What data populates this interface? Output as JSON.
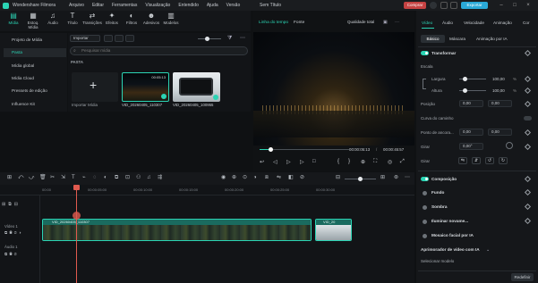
{
  "app": {
    "name": "Wondershare Filmora",
    "file_title": "Sem Título",
    "buy_label": "Comprar",
    "export_label": "Exportar"
  },
  "menu": [
    "Arquivo",
    "Editar",
    "Ferramentas",
    "Visualização",
    "Entendido",
    "Ajuda",
    "Versão"
  ],
  "toolbar": [
    {
      "label": "Mídia",
      "icon": "media-icon"
    },
    {
      "label": "Estoq. Mídia",
      "icon": "stock-media-icon"
    },
    {
      "label": "Áudio",
      "icon": "audio-icon"
    },
    {
      "label": "Título",
      "icon": "title-icon"
    },
    {
      "label": "Transições",
      "icon": "transitions-icon"
    },
    {
      "label": "Efeitos",
      "icon": "effects-icon"
    },
    {
      "label": "Filtros",
      "icon": "filters-icon"
    },
    {
      "label": "Adesivos",
      "icon": "stickers-icon"
    },
    {
      "label": "Modelos",
      "icon": "templates-icon"
    }
  ],
  "sidebar": {
    "items": [
      {
        "label": "Projeto de Mídia"
      },
      {
        "label": "Pasta"
      },
      {
        "label": "Mídia global"
      },
      {
        "label": "Mídia Cloud"
      },
      {
        "label": "Pressets de edição"
      },
      {
        "label": "Influence Kit"
      }
    ]
  },
  "media": {
    "import_label": "Importar",
    "search_placeholder": "Pesquisar mídia",
    "folder_label": "PASTA",
    "import_tile_label": "Importar Mídia",
    "items": [
      {
        "name": "VID_20260405_110307",
        "duration": "00:05:13"
      },
      {
        "name": "VID_20260405_100955",
        "duration": ""
      }
    ]
  },
  "preview": {
    "tab_timeline": "Linha do tempo",
    "tab_source": "Fonte",
    "quality": "Qualidade total",
    "current_time": "00:00:05:13",
    "total_time": "00:00:45:57"
  },
  "right": {
    "tabs": [
      "Vídeo",
      "Áudio",
      "Velocidade",
      "Animação",
      "Cor"
    ],
    "subtabs": [
      "Básico",
      "Máscara",
      "Animação por IA"
    ],
    "transform": "Transformar",
    "scale": "Escala",
    "width": "Largura",
    "width_value": "100,00",
    "height": "Altura",
    "height_value": "100,00",
    "position": "Posição",
    "pos_x": "0,00",
    "pos_y": "0,00",
    "path_curve": "Curva do caminho",
    "anchor": "Ponto de ancora...",
    "anchor_x": "0,00",
    "anchor_y": "0,00",
    "rotate": "Girar",
    "rotate_value": "0,00°",
    "flip": "Girar",
    "composition": "Composição",
    "background": "Fundo",
    "shadow": "Sombra",
    "lighting": "Iluminar novame...",
    "face_mosaic": "Mosaico facial por IA",
    "enhancer": "Aprimorador de vídeo com IA",
    "select_model": "Selecionar modelo",
    "reset": "Redefinir"
  },
  "timeline": {
    "ticks": [
      "00:00",
      "00:00:05:00",
      "00:00:10:00",
      "00:00:15:00",
      "00:00:20:00",
      "00:00:25:00",
      "00:00:30:00"
    ],
    "video_track": "Vídeo 1",
    "audio_track": "Áudio 1",
    "clips": [
      "VID_20260405_110307",
      "VID_20"
    ]
  }
}
